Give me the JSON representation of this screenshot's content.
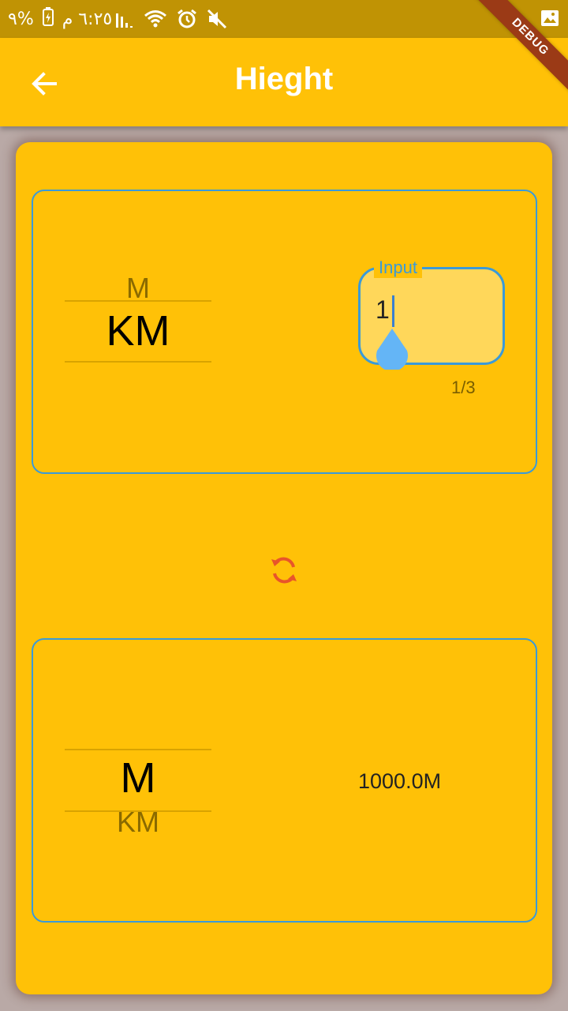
{
  "status_bar": {
    "time": "٦:٢٥ م",
    "battery": "%٩"
  },
  "debug_banner": "DEBUG",
  "app_bar": {
    "title": "Hieght"
  },
  "converter": {
    "from_picker": {
      "options": [
        "M",
        "KM"
      ],
      "selected": "KM"
    },
    "input": {
      "label": "Input",
      "value": "1",
      "counter": "1/3"
    },
    "to_picker": {
      "options": [
        "M",
        "KM"
      ],
      "selected": "M"
    },
    "result": "1000.0M"
  },
  "colors": {
    "primary": "#ffc107",
    "status_bar": "#c09304",
    "border": "#3a9ad9",
    "swap_icon": "#e8552a",
    "debug_ribbon": "#9b3a16"
  }
}
